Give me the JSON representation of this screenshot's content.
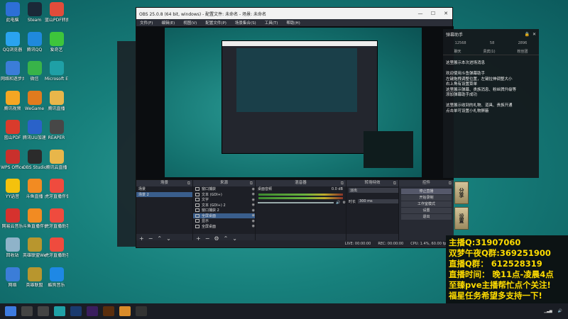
{
  "desktop": {
    "icons": [
      {
        "label": "此电脑",
        "icon": "computer-icon",
        "color": "#2d6fd6"
      },
      {
        "label": "Steam",
        "icon": "steam-icon",
        "color": "#1b2838"
      },
      {
        "label": "蓝山PDF转换器",
        "icon": "pdf-icon",
        "color": "#e24c3b"
      },
      {
        "label": "QQ浏览器",
        "icon": "qq-browser-icon",
        "color": "#2aa3ef"
      },
      {
        "label": "腾讯QQ",
        "icon": "qq-icon",
        "color": "#1f89dd"
      },
      {
        "label": "爱奇艺",
        "icon": "iqiyi-icon",
        "color": "#3ec53b"
      },
      {
        "label": "网络和逐步共享",
        "icon": "network-icon",
        "color": "#3b7dd8"
      },
      {
        "label": "微信",
        "icon": "wechat-icon",
        "color": "#38b349"
      },
      {
        "label": "Microsoft Edge",
        "icon": "edge-icon",
        "color": "#1fa0a6"
      },
      {
        "label": "腾讯视频",
        "icon": "tencent-video-icon",
        "color": "#f5a623"
      },
      {
        "label": "WeGame",
        "icon": "wegame-icon",
        "color": "#e07b1e"
      },
      {
        "label": "腾讯直播",
        "icon": "folder-icon",
        "color": "#e8b64a"
      },
      {
        "label": "蓝山PDF",
        "icon": "pdf-icon",
        "color": "#d93b2c"
      },
      {
        "label": "腾讯UU加速器",
        "icon": "uu-icon",
        "color": "#2a62c9"
      },
      {
        "label": "REAPER",
        "icon": "reaper-icon",
        "color": "#474747"
      },
      {
        "label": "WPS Office",
        "icon": "wps-icon",
        "color": "#c9302c"
      },
      {
        "label": "OBS Studio",
        "icon": "obs-icon",
        "color": "#2b2b2b"
      },
      {
        "label": "腾讯云直播",
        "icon": "folder-icon",
        "color": "#e8b64a"
      },
      {
        "label": "YY语音",
        "icon": "yy-icon",
        "color": "#f4c20d"
      },
      {
        "label": "斗鱼直播",
        "icon": "douyu-icon",
        "color": "#f28b22"
      },
      {
        "label": "虎牙直播伴侣",
        "icon": "huya-icon",
        "color": "#ef4b3e"
      },
      {
        "label": "网易云音乐",
        "icon": "music-icon",
        "color": "#d6322e"
      },
      {
        "label": "斗鱼直播伴侣",
        "icon": "douyu-icon",
        "color": "#f28b22"
      },
      {
        "label": "虎牙直播助手",
        "icon": "huya-icon",
        "color": "#ef4b3e"
      },
      {
        "label": "回收站",
        "icon": "recycle-bin-icon",
        "color": "#8fb3c9"
      },
      {
        "label": "英雄联盟WeGame版",
        "icon": "lol-icon",
        "color": "#b8962e"
      },
      {
        "label": "虎牙直播助手",
        "icon": "huya-icon",
        "color": "#ef4b3e"
      },
      {
        "label": "网络",
        "icon": "network-icon",
        "color": "#3b7dd8"
      },
      {
        "label": "英雄联盟",
        "icon": "lol-icon",
        "color": "#b8962e"
      },
      {
        "label": "酷狗音乐",
        "icon": "kugou-icon",
        "color": "#1e88e5"
      }
    ]
  },
  "obs": {
    "window_title": "OBS 25.0.8 (64 bit, windows) - 配置文件: 未命名 - 场景: 未命名",
    "menu": [
      "文件(F)",
      "编辑(E)",
      "视图(V)",
      "配置文件(P)",
      "场景集合(S)",
      "工具(T)",
      "帮助(H)"
    ],
    "docks": {
      "scenes": {
        "title": "场景",
        "items": [
          "场景",
          "场景 2"
        ]
      },
      "sources": {
        "title": "来源",
        "items": [
          "窗口捕获",
          "文本 (GDI+)",
          "文字",
          "文本 (GDI+) 2",
          "窗口捕获 2",
          "全屏桌面",
          "显示",
          "全屏桌面"
        ]
      },
      "mixer": {
        "title": "混音器",
        "track": "桌面音频",
        "level": "0.0 dB"
      },
      "transitions": {
        "title": "转场特效",
        "type": "淡出",
        "duration_label": "时长",
        "duration": "300 ms"
      },
      "controls": {
        "title": "控件",
        "buttons": [
          "停止直播",
          "开始录制",
          "工作室模式",
          "设置",
          "退出"
        ]
      }
    },
    "status": {
      "live": "LIVE: 00:00:00",
      "rec": "REC: 00:00:00",
      "cpu": "CPU: 1.4%, 60.00 fps"
    }
  },
  "chat": {
    "title": "弹幕助手",
    "stats": [
      "12568",
      "58",
      "2896"
    ],
    "tabs": [
      "聊天",
      "贵宾(1)",
      "粉丝团"
    ],
    "messages": [
      "这里展示本次进场消息",
      "",
      "欢迎使用斗鱼弹幕助手",
      "左键拖拽调整位置，左键拉伸调整大小",
      "右上角有设置菜单",
      "这里展示弹幕、贵族消息、粉丝牌升级等",
      "添加弹幕助手成功",
      "",
      "这里展示收到的礼物、道具、贵族开通",
      "点击单可设置小礼物屏蔽"
    ]
  },
  "side_buttons": [
    "分享",
    "设置"
  ],
  "overlay_info": {
    "lines": [
      "主播Q:31907060",
      "双梦午夜Q群:369251900",
      "直播Q群： 612528319",
      "直播时间： 晚11点-凌晨4点",
      "至臻pve主播帮忙点个关注!",
      "福星任务希望多支持一下!"
    ]
  },
  "taskbar": {
    "icons": [
      {
        "icon": "windows-start-icon",
        "color": "#3d7be0"
      },
      {
        "icon": "search-icon",
        "color": "#444"
      },
      {
        "icon": "task-view-icon",
        "color": "#444"
      },
      {
        "icon": "browser-icon",
        "color": "#1fa0a6"
      },
      {
        "icon": "photoshop-icon",
        "color": "#1a3a6e"
      },
      {
        "icon": "premiere-icon",
        "color": "#3a1e5e"
      },
      {
        "icon": "illustrator-icon",
        "color": "#5a2e0e"
      },
      {
        "icon": "app-icon",
        "color": "#d98b2a"
      },
      {
        "icon": "obs-icon",
        "color": "#333"
      }
    ]
  }
}
